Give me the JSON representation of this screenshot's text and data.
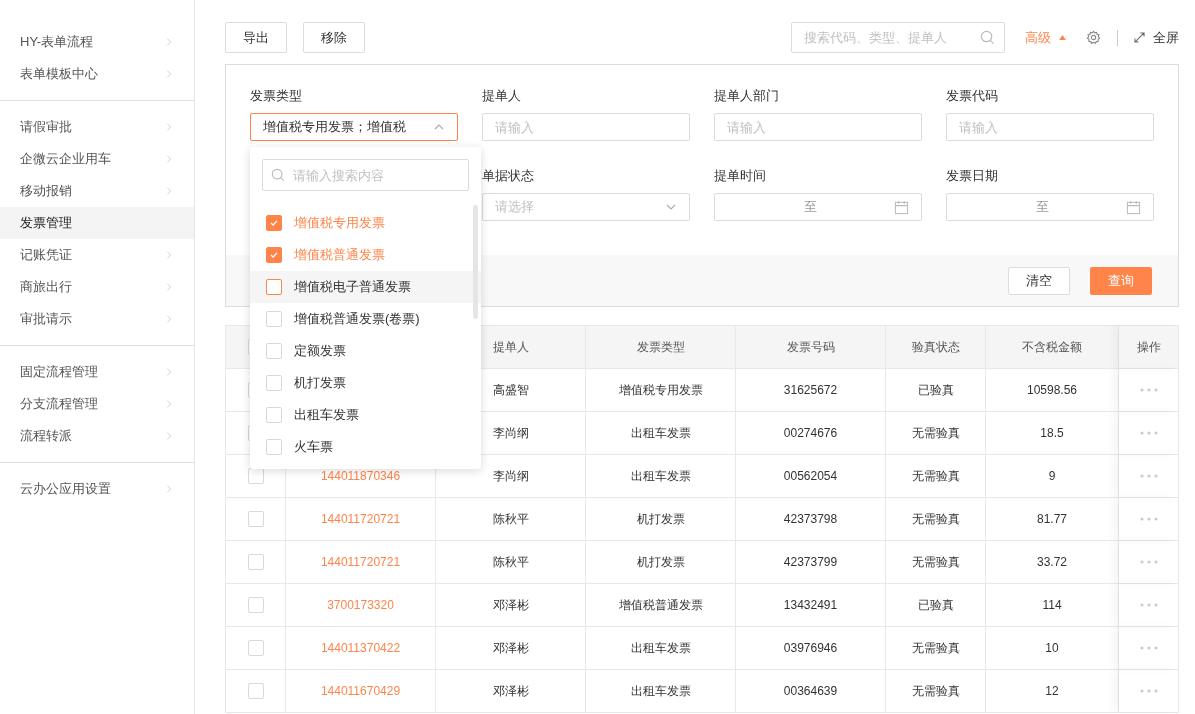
{
  "sidebar": {
    "groups": [
      {
        "items": [
          {
            "label": "HY-表单流程",
            "selected": false
          },
          {
            "label": "表单模板中心",
            "selected": false
          }
        ]
      },
      {
        "items": [
          {
            "label": "请假审批",
            "selected": false
          },
          {
            "label": "企微云企业用车",
            "selected": false
          },
          {
            "label": "移动报销",
            "selected": false
          },
          {
            "label": "发票管理",
            "selected": true
          },
          {
            "label": "记账凭证",
            "selected": false
          },
          {
            "label": "商旅出行",
            "selected": false
          },
          {
            "label": "审批请示",
            "selected": false
          }
        ]
      },
      {
        "items": [
          {
            "label": "固定流程管理",
            "selected": false
          },
          {
            "label": "分支流程管理",
            "selected": false
          },
          {
            "label": "流程转派",
            "selected": false
          }
        ]
      },
      {
        "items": [
          {
            "label": "云办公应用设置",
            "selected": false
          }
        ]
      }
    ]
  },
  "toolbar": {
    "buttons": [
      "导出",
      "移除"
    ],
    "search": {
      "placeholder": "搜索代码、类型、提单人"
    },
    "advanced": {
      "label": "高级",
      "expanded": true
    },
    "fullscreen": "全屏"
  },
  "filters": {
    "rows": [
      [
        {
          "kind": "select",
          "label": "发票类型",
          "value": "增值税专用发票；增值税",
          "expanded": true
        },
        {
          "kind": "input",
          "label": "提单人",
          "placeholder": "请输入"
        },
        {
          "kind": "input",
          "label": "提单人部门",
          "placeholder": "请输入"
        },
        {
          "kind": "input",
          "label": "发票代码",
          "placeholder": "请输入"
        }
      ],
      [
        "",
        {
          "kind": "select",
          "label": "单据状态",
          "placeholder": "请选择",
          "expanded": false
        },
        {
          "kind": "daterange",
          "label": "提单时间",
          "separator": "至"
        },
        {
          "kind": "daterange",
          "label": "发票日期",
          "separator": "至"
        }
      ]
    ],
    "buttons": [
      {
        "label": "清空",
        "primary": false
      },
      {
        "label": "查询",
        "primary": true
      }
    ]
  },
  "dropdown": {
    "search_placeholder": "请输入搜索内容",
    "options": [
      {
        "label": "增值税专用发票",
        "checked": true,
        "hovered": false
      },
      {
        "label": "增值税普通发票",
        "checked": true,
        "hovered": false
      },
      {
        "label": "增值税电子普通发票",
        "checked": false,
        "hovered": true
      },
      {
        "label": "增值税普通发票(卷票)",
        "checked": false,
        "hovered": false
      },
      {
        "label": "定额发票",
        "checked": false,
        "hovered": false
      },
      {
        "label": "机打发票",
        "checked": false,
        "hovered": false
      },
      {
        "label": "出租车发票",
        "checked": false,
        "hovered": false
      },
      {
        "label": "火车票",
        "checked": false,
        "hovered": false
      }
    ]
  },
  "table": {
    "select_all_checked": false,
    "columns": [
      "提单人",
      "发票类型",
      "发票号码",
      "验真状态",
      "不含税金额",
      "操作"
    ],
    "rows": [
      {
        "checked": false,
        "submitter": "高盛智",
        "type": "增值税专用发票",
        "number": "31625672",
        "status": "已验真",
        "amount": "10598.56"
      },
      {
        "checked": false,
        "submitter": "李尚纲",
        "type": "出租车发票",
        "number": "00274676",
        "status": "无需验真",
        "amount": "18.5"
      },
      {
        "checked": false,
        "code": "144011870346",
        "submitter": "李尚纲",
        "type": "出租车发票",
        "number": "00562054",
        "status": "无需验真",
        "amount": "9"
      },
      {
        "checked": false,
        "code": "144011720721",
        "submitter": "陈秋平",
        "type": "机打发票",
        "number": "42373798",
        "status": "无需验真",
        "amount": "81.77"
      },
      {
        "checked": false,
        "code": "144011720721",
        "submitter": "陈秋平",
        "type": "机打发票",
        "number": "42373799",
        "status": "无需验真",
        "amount": "33.72"
      },
      {
        "checked": false,
        "code": "3700173320",
        "submitter": "邓泽彬",
        "type": "增值税普通发票",
        "number": "13432491",
        "status": "已验真",
        "amount": "114"
      },
      {
        "checked": false,
        "code": "144011370422",
        "submitter": "邓泽彬",
        "type": "出租车发票",
        "number": "03976946",
        "status": "无需验真",
        "amount": "10"
      },
      {
        "checked": false,
        "code": "144011670429",
        "submitter": "邓泽彬",
        "type": "出租车发票",
        "number": "00364639",
        "status": "无需验真",
        "amount": "12"
      }
    ]
  }
}
